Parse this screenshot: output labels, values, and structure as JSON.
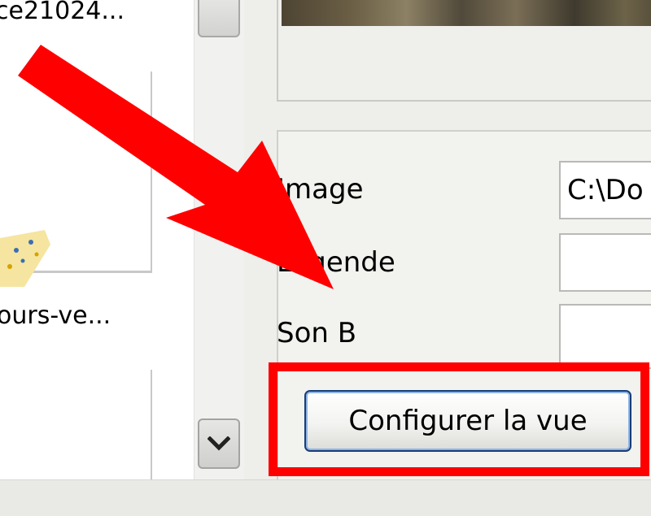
{
  "thumbnails": [
    {
      "label": "ce21024..."
    },
    {
      "label": "ours-ve..."
    }
  ],
  "fields": {
    "image": {
      "label": "Image",
      "value": "C:\\Do"
    },
    "legende": {
      "label": "Légende",
      "value": ""
    },
    "son": {
      "label": "Son B",
      "value": ""
    }
  },
  "buttons": {
    "configure_view": "Configurer la vue"
  },
  "annotations": {
    "highlight_color": "#ff0000",
    "arrow_color": "#ff0000"
  },
  "icons": {
    "scroll_down": "chevron-down-icon",
    "pointer": "arrow-annotation-icon"
  }
}
